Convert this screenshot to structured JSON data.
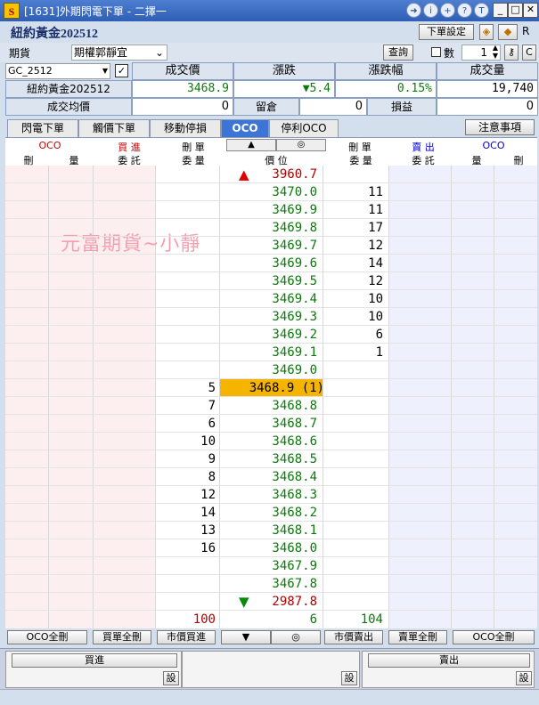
{
  "window": {
    "app_icon": "S",
    "title": "[1631]外期閃電下單 - 二擇一",
    "control_icons": [
      "arrow-right-icon",
      "info-icon",
      "add-icon",
      "help-icon",
      "t-icon"
    ]
  },
  "product": {
    "name": "紐約黃金202512",
    "settings_button": "下單設定",
    "r_label": "R"
  },
  "order_bar": {
    "type_label": "期貨",
    "strategy": "期權郭靜宜",
    "query_button": "查詢",
    "qty_checkbox_label": "數",
    "qty_value": "1",
    "c_label": "C"
  },
  "quote": {
    "symbol": "GC_2512",
    "symbol_name": "紐約黃金202512",
    "headers": [
      "成交價",
      "漲跌",
      "漲跌幅",
      "成交量"
    ],
    "last_price": "3468.9",
    "change": "5.4",
    "change_pct": "0.15%",
    "volume": "19,740",
    "avg_label": "成交均價",
    "avg_value": "0",
    "keep_label": "留倉",
    "keep_value": "0",
    "pnl_label": "損益",
    "pnl_value": "0"
  },
  "tabs": [
    "閃電下單",
    "觸價下單",
    "移動停損",
    "OCO",
    "停利OCO"
  ],
  "active_tab": 3,
  "notice_button": "注意事項",
  "ladder_header": {
    "oco_left": "OCO",
    "buy_title": "買 進",
    "cancel_left_title": "刪 單",
    "up_arrow": "▲",
    "center_icon": "◎",
    "cancel_right_title": "刪 單",
    "sell_title": "賣 出",
    "oco_right": "OCO",
    "sub": [
      "刪",
      "量",
      "委 託",
      "委 量",
      "價 位",
      "委 量",
      "委 託",
      "量",
      "刪"
    ]
  },
  "watermark": "元富期貨~小靜",
  "ladder": [
    {
      "price": "3960.7",
      "ask": "",
      "bid": "",
      "marker": "up"
    },
    {
      "price": "3470.0",
      "ask": "11",
      "bid": ""
    },
    {
      "price": "3469.9",
      "ask": "11",
      "bid": ""
    },
    {
      "price": "3469.8",
      "ask": "17",
      "bid": ""
    },
    {
      "price": "3469.7",
      "ask": "12",
      "bid": ""
    },
    {
      "price": "3469.6",
      "ask": "14",
      "bid": ""
    },
    {
      "price": "3469.5",
      "ask": "12",
      "bid": ""
    },
    {
      "price": "3469.4",
      "ask": "10",
      "bid": ""
    },
    {
      "price": "3469.3",
      "ask": "10",
      "bid": ""
    },
    {
      "price": "3469.2",
      "ask": "6",
      "bid": ""
    },
    {
      "price": "3469.1",
      "ask": "1",
      "bid": ""
    },
    {
      "price": "3469.0",
      "ask": "",
      "bid": ""
    },
    {
      "price": "3468.9 (1)",
      "ask": "",
      "bid": "5",
      "marker": "last"
    },
    {
      "price": "3468.8",
      "ask": "",
      "bid": "7"
    },
    {
      "price": "3468.7",
      "ask": "",
      "bid": "6"
    },
    {
      "price": "3468.6",
      "ask": "",
      "bid": "10"
    },
    {
      "price": "3468.5",
      "ask": "",
      "bid": "9"
    },
    {
      "price": "3468.4",
      "ask": "",
      "bid": "8"
    },
    {
      "price": "3468.3",
      "ask": "",
      "bid": "12"
    },
    {
      "price": "3468.2",
      "ask": "",
      "bid": "14"
    },
    {
      "price": "3468.1",
      "ask": "",
      "bid": "13"
    },
    {
      "price": "3468.0",
      "ask": "",
      "bid": "16"
    },
    {
      "price": "3467.9",
      "ask": "",
      "bid": ""
    },
    {
      "price": "3467.8",
      "ask": "",
      "bid": ""
    },
    {
      "price": "2987.8",
      "ask": "",
      "bid": "",
      "marker": "down"
    }
  ],
  "totals": {
    "bid_total": "100",
    "mid_total": "6",
    "ask_total": "104"
  },
  "bottom_buttons": [
    "OCO全刪",
    "買單全刪",
    "市價買進",
    "▼",
    "◎",
    "市價賣出",
    "賣單全刪",
    "OCO全刪"
  ],
  "order_panel": {
    "buy_label": "買進",
    "sell_label": "賣出",
    "set_label": "設"
  },
  "colors": {
    "buy": "#ff0000",
    "sell": "#0000cc",
    "up": "#008000",
    "down": "#cc0000",
    "last_price_bg": "#f4b400",
    "titlebar": "#3a6cc4"
  }
}
